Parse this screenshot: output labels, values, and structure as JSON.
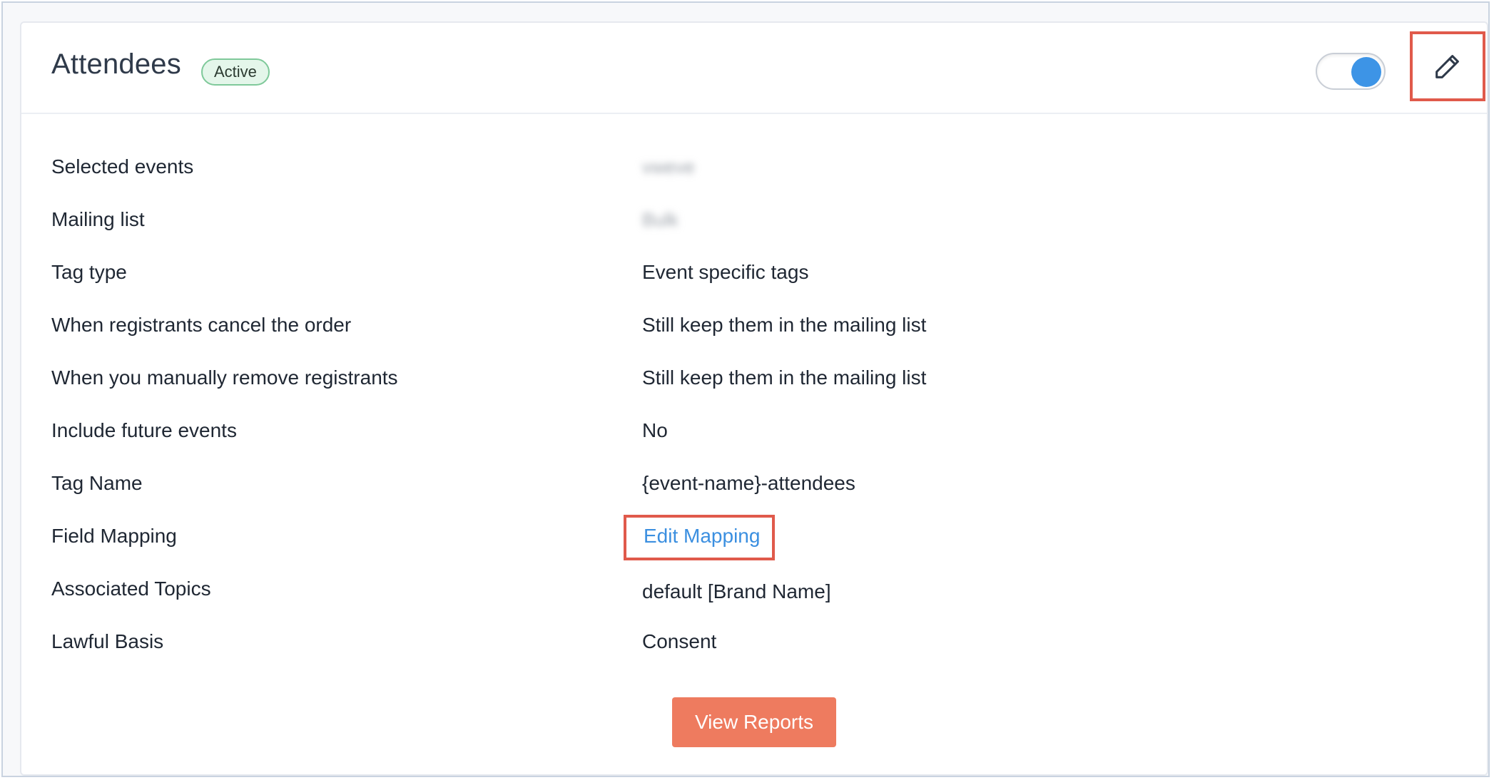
{
  "header": {
    "title": "Attendees",
    "status": "Active",
    "toggle_on": true
  },
  "rows": [
    {
      "label": "Selected events",
      "value": "vweve"
    },
    {
      "label": "Mailing list",
      "value": "Bulk"
    },
    {
      "label": "Tag type",
      "value": "Event specific tags"
    },
    {
      "label": "When registrants cancel the order",
      "value": "Still keep them in the mailing list"
    },
    {
      "label": "When you manually remove registrants",
      "value": "Still keep them in the mailing list"
    },
    {
      "label": "Include future events",
      "value": "No"
    },
    {
      "label": "Tag Name",
      "value": "{event-name}-attendees"
    },
    {
      "label": "Field Mapping",
      "value": "Edit Mapping"
    },
    {
      "label": "Associated Topics",
      "value": "default [Brand Name]"
    },
    {
      "label": "Lawful Basis",
      "value": "Consent"
    }
  ],
  "actions": {
    "view_reports": "View Reports"
  },
  "colors": {
    "accent": "#3d94e6",
    "highlight": "#e05a4b",
    "button": "#ee7b5f",
    "badge_bg": "#e4f6ea"
  },
  "icons": {
    "edit": "pencil-icon"
  }
}
